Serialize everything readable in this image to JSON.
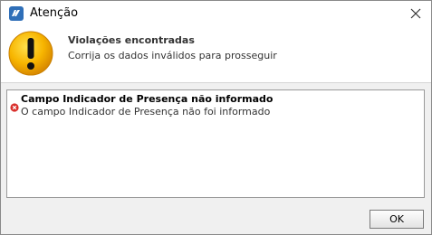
{
  "window": {
    "title": "Atenção",
    "app_icon": "app-logo-icon",
    "close_icon": "close-icon"
  },
  "header": {
    "icon": "warning-icon",
    "title": "Violações encontradas",
    "subtitle": "Corrija os dados inválidos para prosseguir"
  },
  "messages": [
    {
      "icon": "error-icon",
      "title": "Campo Indicador de Presença não informado",
      "body": "O campo Indicador de Presença não foi informado"
    }
  ],
  "buttons": {
    "ok_label": "OK"
  },
  "colors": {
    "warning": "#f5a800",
    "error": "#d9302c",
    "app_icon": "#2f6fb8"
  }
}
